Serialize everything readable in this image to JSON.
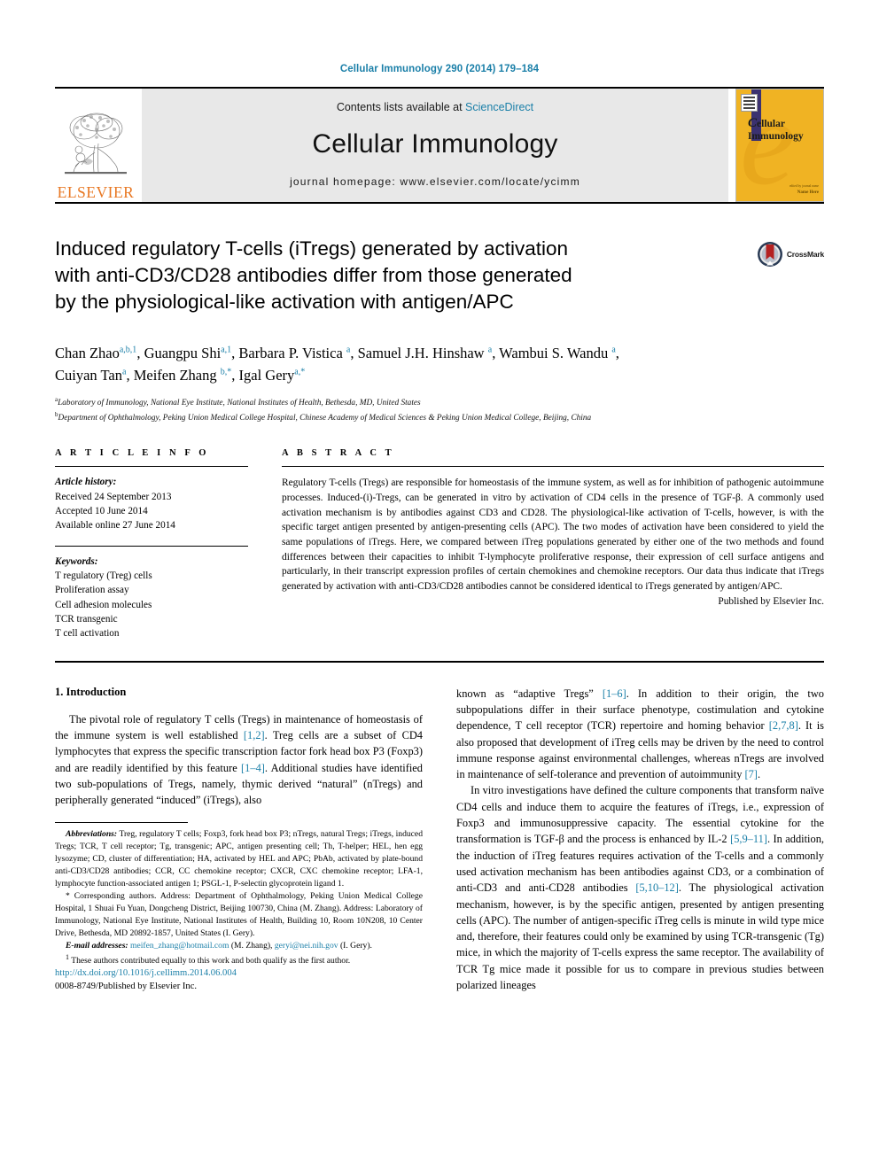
{
  "running_head": "Cellular Immunology 290 (2014) 179–184",
  "masthead": {
    "publisher": "ELSEVIER",
    "contents_prefix": "Contents lists available at ",
    "contents_link": "ScienceDirect",
    "journal_title": "Cellular Immunology",
    "homepage": "journal homepage: www.elsevier.com/locate/ycimm",
    "cover": {
      "title_line1": "ellular",
      "title_line2": "Immunology",
      "initial": "C",
      "foot_small": "edited by journal name",
      "foot_bold": "Name Here"
    }
  },
  "article": {
    "title_line1": "Induced regulatory T-cells (iTregs) generated by activation",
    "title_line2": "with anti-CD3/CD28 antibodies differ from those generated",
    "title_line3": "by the physiological-like activation with antigen/APC",
    "crossmark_label": "CrossMark",
    "authors_line1_parts": [
      {
        "name": "Chan Zhao",
        "sup": "a,b,1",
        "sep": ", "
      },
      {
        "name": "Guangpu Shi",
        "sup": "a,1",
        "sep": ", "
      },
      {
        "name": "Barbara P. Vistica ",
        "sup": "a",
        "sep": ", "
      },
      {
        "name": "Samuel J.H. Hinshaw ",
        "sup": "a",
        "sep": ", "
      },
      {
        "name": "Wambui S. Wandu ",
        "sup": "a",
        "sep": ","
      }
    ],
    "authors_line2_parts": [
      {
        "name": "Cuiyan Tan",
        "sup": "a",
        "sep": ", "
      },
      {
        "name": "Meifen Zhang ",
        "sup": "b,*",
        "sep": ", "
      },
      {
        "name": "Igal Gery",
        "sup": "a,*",
        "sep": ""
      }
    ],
    "affiliation_a_sup": "a",
    "affiliation_a": "Laboratory of Immunology, National Eye Institute, National Institutes of Health, Bethesda, MD, United States",
    "affiliation_b_sup": "b",
    "affiliation_b": "Department of Ophthalmology, Peking Union Medical College Hospital, Chinese Academy of Medical Sciences & Peking Union Medical College, Beijing, China"
  },
  "article_info": {
    "heading": "A R T I C L E  I N F O",
    "history_label": "Article history:",
    "history": [
      "Received 24 September 2013",
      "Accepted 10 June 2014",
      "Available online 27 June 2014"
    ],
    "keywords_label": "Keywords:",
    "keywords": [
      "T regulatory (Treg) cells",
      "Proliferation assay",
      "Cell adhesion molecules",
      "TCR transgenic",
      "T cell activation"
    ]
  },
  "abstract": {
    "heading": "A B S T R A C T",
    "text": "Regulatory T-cells (Tregs) are responsible for homeostasis of the immune system, as well as for inhibition of pathogenic autoimmune processes. Induced-(i)-Tregs, can be generated in vitro by activation of CD4 cells in the presence of TGF-β. A commonly used activation mechanism is by antibodies against CD3 and CD28. The physiological-like activation of T-cells, however, is with the specific target antigen presented by antigen-presenting cells (APC). The two modes of activation have been considered to yield the same populations of iTregs. Here, we compared between iTreg populations generated by either one of the two methods and found differences between their capacities to inhibit T-lymphocyte proliferative response, their expression of cell surface antigens and particularly, in their transcript expression profiles of certain chemokines and chemokine receptors. Our data thus indicate that iTregs generated by activation with anti-CD3/CD28 antibodies cannot be considered identical to iTregs generated by antigen/APC.",
    "publisher_line": "Published by Elsevier Inc."
  },
  "body": {
    "section_heading": "1. Introduction",
    "left_paragraph_1": {
      "t1": "The pivotal role of regulatory T cells (Tregs) in maintenance of homeostasis of the immune system is well established ",
      "r1": "[1,2]",
      "t2": ". Treg cells are a subset of CD4 lymphocytes that express the specific transcription factor fork head box P3 (Foxp3) and are readily identified by this feature ",
      "r2": "[1–4]",
      "t3": ". Additional studies have identified two sub-populations of Tregs, namely, thymic derived “natural” (nTregs) and peripherally generated “induced” (iTregs), also"
    },
    "right_paragraph_1": {
      "t1": "known as “adaptive Tregs” ",
      "r1": "[1–6]",
      "t2": ". In addition to their origin, the two subpopulations differ in their surface phenotype, costimulation and cytokine dependence, T cell receptor (TCR) repertoire and homing behavior ",
      "r2": "[2,7,8]",
      "t3": ". It is also proposed that development of iTreg cells may be driven by the need to control immune response against environmental challenges, whereas nTregs are involved in maintenance of self-tolerance and prevention of autoimmunity ",
      "r3": "[7]",
      "t4": "."
    },
    "right_paragraph_2": {
      "t1": "In vitro investigations have defined the culture components that transform naïve CD4 cells and induce them to acquire the features of iTregs, i.e., expression of Foxp3 and immunosuppressive capacity. The essential cytokine for the transformation is TGF-β and the process is enhanced by IL-2 ",
      "r1": "[5,9–11]",
      "t2": ". In addition, the induction of iTreg features requires activation of the T-cells and a commonly used activation mechanism has been antibodies against CD3, or a combination of anti-CD3 and anti-CD28 antibodies ",
      "r2": "[5,10–12]",
      "t3": ". The physiological activation mechanism, however, is by the specific antigen, presented by antigen presenting cells (APC). The number of antigen-specific iTreg cells is minute in wild type mice and, therefore, their features could only be examined by using TCR-transgenic (Tg) mice, in which the majority of T-cells express the same receptor. The availability of TCR Tg mice made it possible for us to compare in previous studies between polarized lineages"
    }
  },
  "footnotes": {
    "abbreviations_label": "Abbreviations:",
    "abbreviations_text": " Treg, regulatory T cells; Foxp3, fork head box P3; nTregs, natural Tregs; iTregs, induced Tregs; TCR, T cell receptor; Tg, transgenic; APC, antigen presenting cell; Th, T-helper; HEL, hen egg lysozyme; CD, cluster of differentiation; HA, activated by HEL and APC; PbAb, activated by plate-bound anti-CD3/CD28 antibodies; CCR, CC chemokine receptor; CXCR, CXC chemokine receptor; LFA-1, lymphocyte function-associated antigen 1; PSGL-1, P-selectin glycoprotein ligand 1.",
    "corresponding_marker": "*",
    "corresponding_text": " Corresponding authors. Address: Department of Ophthalmology, Peking Union Medical College Hospital, 1 Shuai Fu Yuan, Dongcheng District, Beijing 100730, China (M. Zhang). Address: Laboratory of Immunology, National Eye Institute, National Institutes of Health, Building 10, Room 10N208, 10 Center Drive, Bethesda, MD 20892-1857, United States (I. Gery).",
    "email_label": "E-mail addresses:",
    "email_1": "meifen_zhang@hotmail.com",
    "email_1_who": " (M. Zhang), ",
    "email_2": "geryi@nei.nih.gov",
    "email_2_who": " (I. Gery).",
    "equal_marker": "1",
    "equal_text": " These authors contributed equally to this work and both qualify as the first author."
  },
  "doi": {
    "url": "http://dx.doi.org/10.1016/j.cellimm.2014.06.004",
    "issn_line": "0008-8749/Published by Elsevier Inc."
  },
  "colors": {
    "link": "#1a7fa8",
    "elsevier_orange": "#e87722",
    "cover_yellow": "#f0b323",
    "masthead_gray": "#e8e8e8"
  }
}
